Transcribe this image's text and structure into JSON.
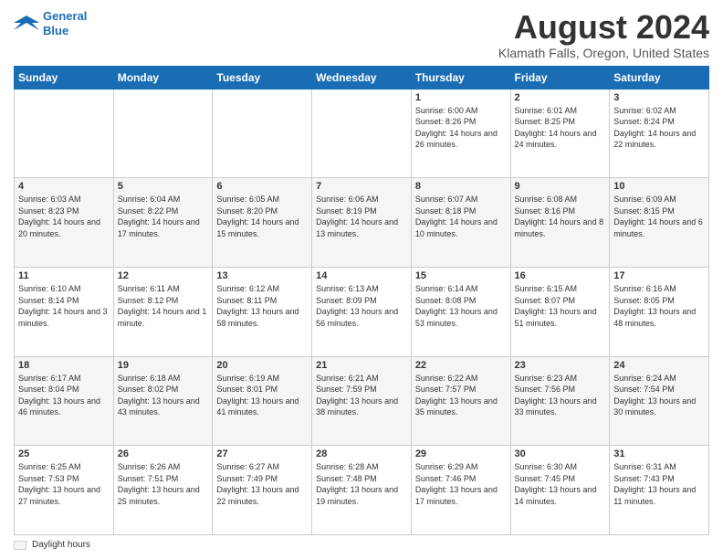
{
  "logo": {
    "line1": "General",
    "line2": "Blue"
  },
  "title": "August 2024",
  "subtitle": "Klamath Falls, Oregon, United States",
  "days_of_week": [
    "Sunday",
    "Monday",
    "Tuesday",
    "Wednesday",
    "Thursday",
    "Friday",
    "Saturday"
  ],
  "weeks": [
    [
      {
        "day": "",
        "info": ""
      },
      {
        "day": "",
        "info": ""
      },
      {
        "day": "",
        "info": ""
      },
      {
        "day": "",
        "info": ""
      },
      {
        "day": "1",
        "info": "Sunrise: 6:00 AM\nSunset: 8:26 PM\nDaylight: 14 hours and 26 minutes."
      },
      {
        "day": "2",
        "info": "Sunrise: 6:01 AM\nSunset: 8:25 PM\nDaylight: 14 hours and 24 minutes."
      },
      {
        "day": "3",
        "info": "Sunrise: 6:02 AM\nSunset: 8:24 PM\nDaylight: 14 hours and 22 minutes."
      }
    ],
    [
      {
        "day": "4",
        "info": "Sunrise: 6:03 AM\nSunset: 8:23 PM\nDaylight: 14 hours and 20 minutes."
      },
      {
        "day": "5",
        "info": "Sunrise: 6:04 AM\nSunset: 8:22 PM\nDaylight: 14 hours and 17 minutes."
      },
      {
        "day": "6",
        "info": "Sunrise: 6:05 AM\nSunset: 8:20 PM\nDaylight: 14 hours and 15 minutes."
      },
      {
        "day": "7",
        "info": "Sunrise: 6:06 AM\nSunset: 8:19 PM\nDaylight: 14 hours and 13 minutes."
      },
      {
        "day": "8",
        "info": "Sunrise: 6:07 AM\nSunset: 8:18 PM\nDaylight: 14 hours and 10 minutes."
      },
      {
        "day": "9",
        "info": "Sunrise: 6:08 AM\nSunset: 8:16 PM\nDaylight: 14 hours and 8 minutes."
      },
      {
        "day": "10",
        "info": "Sunrise: 6:09 AM\nSunset: 8:15 PM\nDaylight: 14 hours and 6 minutes."
      }
    ],
    [
      {
        "day": "11",
        "info": "Sunrise: 6:10 AM\nSunset: 8:14 PM\nDaylight: 14 hours and 3 minutes."
      },
      {
        "day": "12",
        "info": "Sunrise: 6:11 AM\nSunset: 8:12 PM\nDaylight: 14 hours and 1 minute."
      },
      {
        "day": "13",
        "info": "Sunrise: 6:12 AM\nSunset: 8:11 PM\nDaylight: 13 hours and 58 minutes."
      },
      {
        "day": "14",
        "info": "Sunrise: 6:13 AM\nSunset: 8:09 PM\nDaylight: 13 hours and 56 minutes."
      },
      {
        "day": "15",
        "info": "Sunrise: 6:14 AM\nSunset: 8:08 PM\nDaylight: 13 hours and 53 minutes."
      },
      {
        "day": "16",
        "info": "Sunrise: 6:15 AM\nSunset: 8:07 PM\nDaylight: 13 hours and 51 minutes."
      },
      {
        "day": "17",
        "info": "Sunrise: 6:16 AM\nSunset: 8:05 PM\nDaylight: 13 hours and 48 minutes."
      }
    ],
    [
      {
        "day": "18",
        "info": "Sunrise: 6:17 AM\nSunset: 8:04 PM\nDaylight: 13 hours and 46 minutes."
      },
      {
        "day": "19",
        "info": "Sunrise: 6:18 AM\nSunset: 8:02 PM\nDaylight: 13 hours and 43 minutes."
      },
      {
        "day": "20",
        "info": "Sunrise: 6:19 AM\nSunset: 8:01 PM\nDaylight: 13 hours and 41 minutes."
      },
      {
        "day": "21",
        "info": "Sunrise: 6:21 AM\nSunset: 7:59 PM\nDaylight: 13 hours and 38 minutes."
      },
      {
        "day": "22",
        "info": "Sunrise: 6:22 AM\nSunset: 7:57 PM\nDaylight: 13 hours and 35 minutes."
      },
      {
        "day": "23",
        "info": "Sunrise: 6:23 AM\nSunset: 7:56 PM\nDaylight: 13 hours and 33 minutes."
      },
      {
        "day": "24",
        "info": "Sunrise: 6:24 AM\nSunset: 7:54 PM\nDaylight: 13 hours and 30 minutes."
      }
    ],
    [
      {
        "day": "25",
        "info": "Sunrise: 6:25 AM\nSunset: 7:53 PM\nDaylight: 13 hours and 27 minutes."
      },
      {
        "day": "26",
        "info": "Sunrise: 6:26 AM\nSunset: 7:51 PM\nDaylight: 13 hours and 25 minutes."
      },
      {
        "day": "27",
        "info": "Sunrise: 6:27 AM\nSunset: 7:49 PM\nDaylight: 13 hours and 22 minutes."
      },
      {
        "day": "28",
        "info": "Sunrise: 6:28 AM\nSunset: 7:48 PM\nDaylight: 13 hours and 19 minutes."
      },
      {
        "day": "29",
        "info": "Sunrise: 6:29 AM\nSunset: 7:46 PM\nDaylight: 13 hours and 17 minutes."
      },
      {
        "day": "30",
        "info": "Sunrise: 6:30 AM\nSunset: 7:45 PM\nDaylight: 13 hours and 14 minutes."
      },
      {
        "day": "31",
        "info": "Sunrise: 6:31 AM\nSunset: 7:43 PM\nDaylight: 13 hours and 11 minutes."
      }
    ]
  ],
  "footer": {
    "daylight_label": "Daylight hours"
  }
}
